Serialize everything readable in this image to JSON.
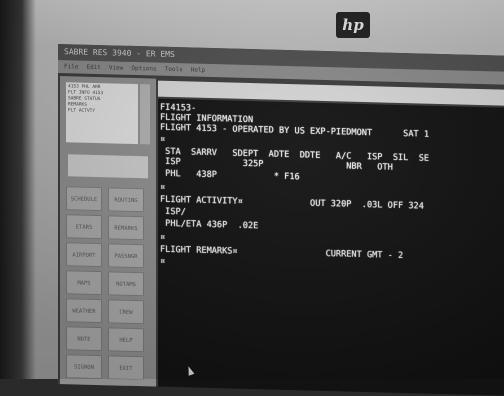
{
  "brand": {
    "logo_text": "hp"
  },
  "window": {
    "title": "SABRE RES 3940 - ER EMS"
  },
  "menu": {
    "items": [
      "File",
      "Edit",
      "View",
      "Options",
      "Tools",
      "Help"
    ]
  },
  "left_panel": {
    "list_lines": [
      "4153 PHL ARR",
      "FLT INFO 4153",
      "SABRE STATUS",
      "REMARKS",
      "FLT ACTVTY"
    ],
    "buttons": [
      "SCHEDULE",
      "ROUTING",
      "ETARS",
      "REMARKS",
      "AIRPORT",
      "PASSNGR",
      "MAPS",
      "NOTAMS",
      "WEATHER",
      "CREW",
      "NOTE",
      "HELP",
      "SIGNON",
      "EXIT"
    ]
  },
  "terminal": {
    "lines": [
      "FI4153-",
      "FLIGHT INFORMATION",
      "FLIGHT 4153 - OPERATED BY US EXP-PIEDMONT      SAT 1",
      "¤",
      " STA  SARRV   SDEPT  ADTE  DDTE   A/C   ISP  SIL  SE",
      " ISP            325P                NBR   OTH",
      " PHL   438P           * F16",
      "¤",
      "FLIGHT ACTIVITY¤             OUT 320P  .03L OFF 324",
      " ISP/",
      " PHL/ETA 436P  .02E",
      "¤",
      "FLIGHT REMARKS¤                 CURRENT GMT - 2",
      "¤"
    ]
  }
}
